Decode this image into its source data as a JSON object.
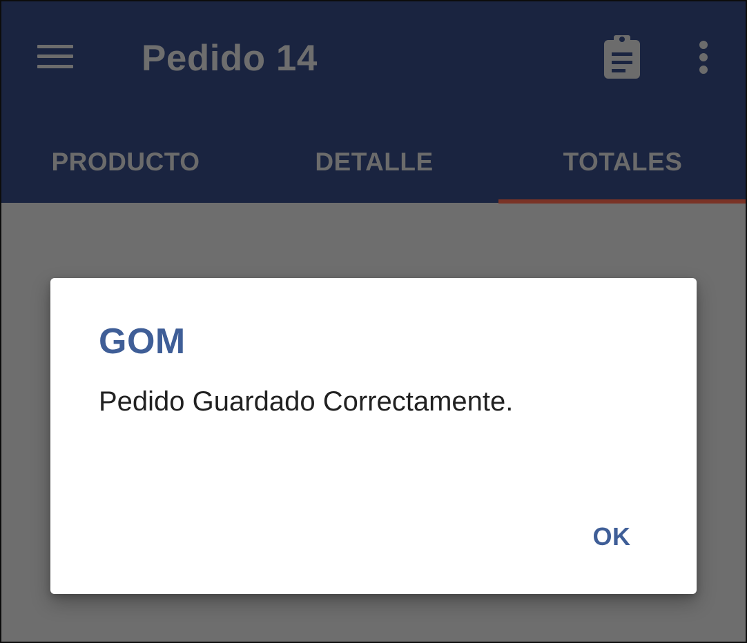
{
  "toolbar": {
    "title": "Pedido 14",
    "icons": {
      "menu": "menu-icon",
      "clipboard": "clipboard-icon",
      "more": "more-vert-icon"
    }
  },
  "tabs": [
    {
      "label": "PRODUCTO",
      "selected": false
    },
    {
      "label": "DETALLE",
      "selected": false
    },
    {
      "label": "TOTALES",
      "selected": true
    }
  ],
  "dialog": {
    "title": "GOM",
    "message": "Pedido Guardado Correctamente.",
    "ok_label": "OK"
  },
  "colors": {
    "appbar": "#1a2440",
    "scrim_background": "#6e6e6e",
    "tab_indicator": "#7a3326",
    "dialog_accent": "#3f5e97",
    "dialog_text": "#212121"
  }
}
